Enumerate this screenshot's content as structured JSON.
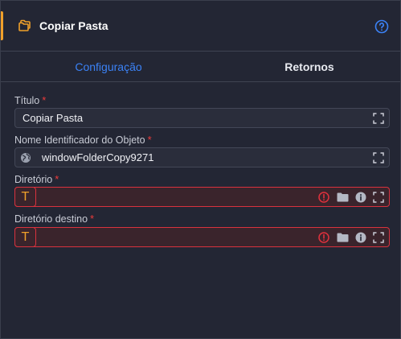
{
  "header": {
    "title": "Copiar Pasta",
    "icon": "copy-folder-icon",
    "help_icon": "help-circle-icon",
    "accent_color": "#f0a02a"
  },
  "tabs": [
    {
      "label": "Configuração",
      "active": true
    },
    {
      "label": "Retornos",
      "active": false
    }
  ],
  "fields": {
    "titulo": {
      "label": "Título",
      "required": "*",
      "value": "Copiar Pasta"
    },
    "object_id": {
      "label": "Nome Identificador do Objeto",
      "required": "*",
      "value": "windowFolderCopy9271"
    },
    "diretorio": {
      "label": "Diretório",
      "required": "*",
      "value": "",
      "type_badge": "T"
    },
    "diretorio_destino": {
      "label": "Diretório destino",
      "required": "*",
      "value": "",
      "type_badge": "T"
    }
  },
  "colors": {
    "active_tab": "#3b82f6",
    "error": "#d9323e",
    "required": "#ef3b3b"
  }
}
